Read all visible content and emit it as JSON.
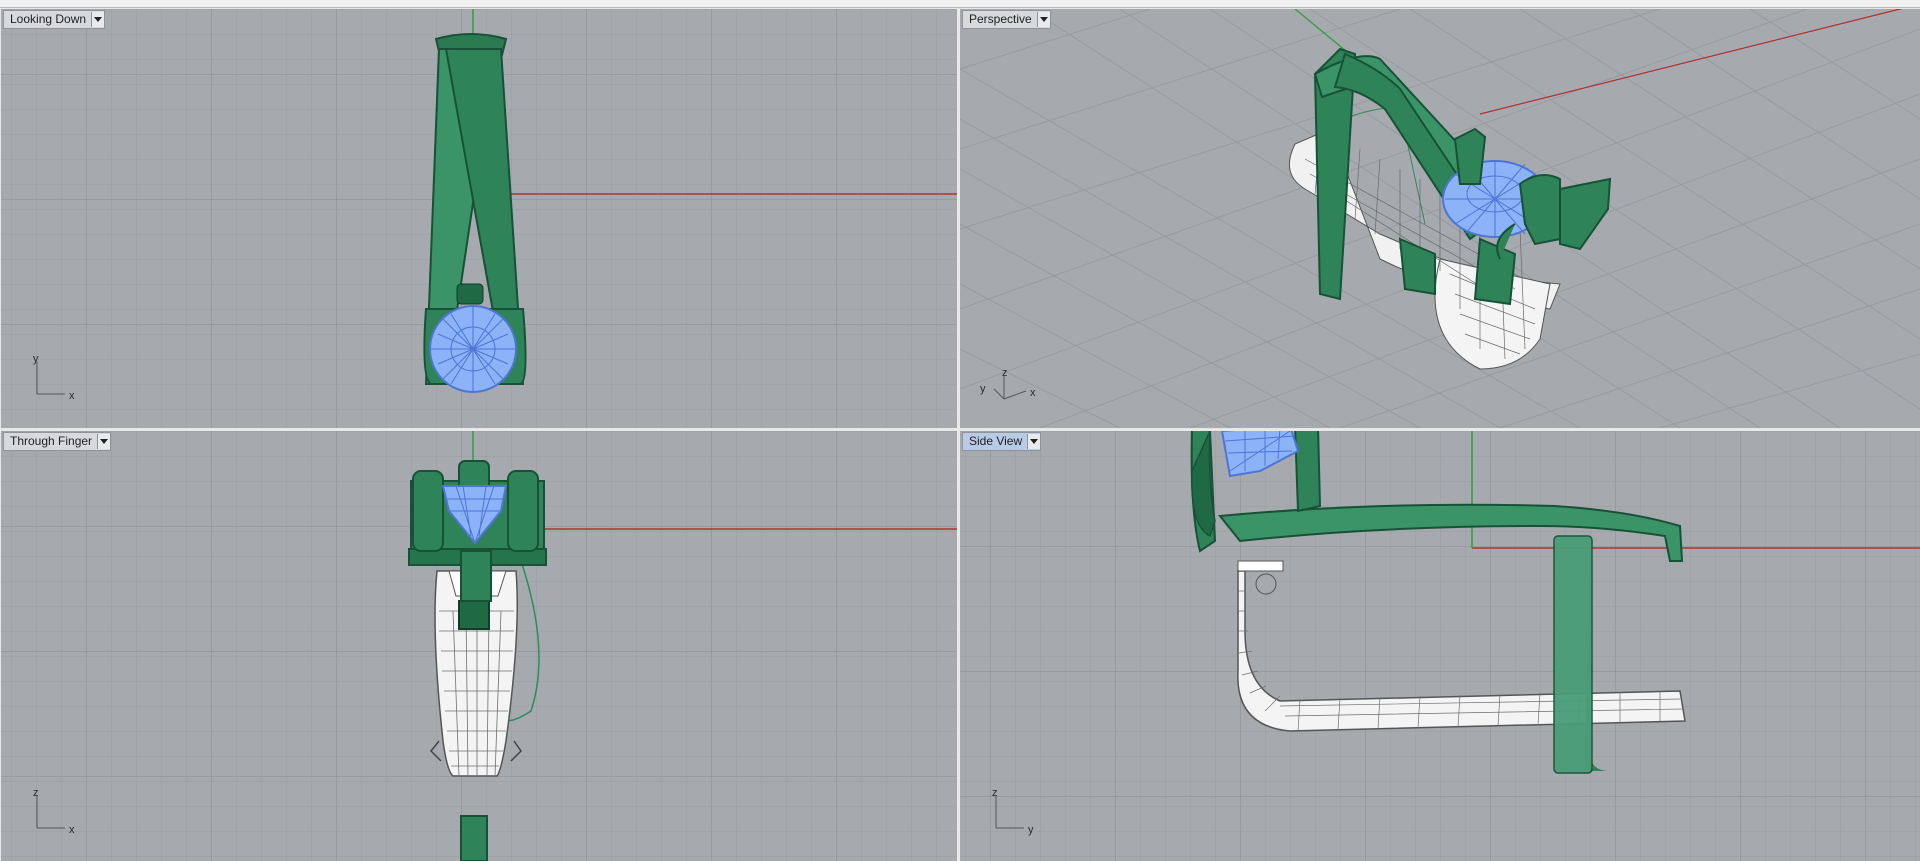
{
  "viewports": {
    "top_left": {
      "title": "Looking Down",
      "axis_labels": {
        "a": "y",
        "b": "x"
      }
    },
    "top_right": {
      "title": "Perspective",
      "axis_labels": {
        "a": "y",
        "b": "z",
        "c": "x"
      }
    },
    "bottom_left": {
      "title": "Through Finger",
      "axis_labels": {
        "a": "z",
        "b": "x"
      }
    },
    "bottom_right": {
      "title": "Side View",
      "axis_labels": {
        "a": "z",
        "b": "y"
      },
      "active": true
    }
  },
  "colors": {
    "viewport_bg": "#a6aaae",
    "grid_minor": "#9a9ea3",
    "grid_major": "#8b8f94",
    "x_axis": "#b2322f",
    "y_axis": "#2fa03a",
    "model_green": "#2e8b5c",
    "model_green_dark": "#1d5f3c",
    "gem_blue": "#7fa6f0",
    "shank_white": "#f2f2f2"
  },
  "icons": {
    "viewport_menu": "triangle-down-icon"
  }
}
